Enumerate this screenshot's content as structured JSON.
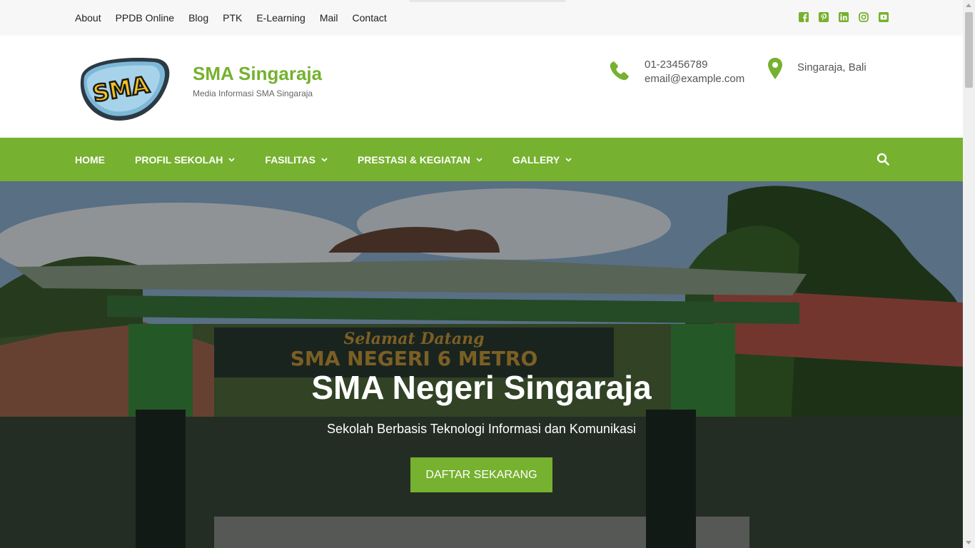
{
  "topbar": {
    "links": [
      "About",
      "PPDB Online",
      "Blog",
      "PTK",
      "E-Learning",
      "Mail",
      "Contact"
    ],
    "social_icons": [
      "facebook-icon",
      "pinterest-icon",
      "linkedin-icon",
      "instagram-icon",
      "youtube-icon"
    ]
  },
  "header": {
    "logo_text": "SMA",
    "site_title": "SMA Singaraja",
    "tagline": "Media Informasi SMA Singaraja",
    "phone": "01-23456789",
    "email": "email@example.com",
    "location": "Singaraja, Bali"
  },
  "nav": {
    "items": [
      "HOME",
      "PROFIL SEKOLAH",
      "FASILITAS",
      "PRESTASI & KEGIATAN",
      "GALLERY"
    ],
    "has_dropdown": [
      false,
      true,
      true,
      true,
      true
    ]
  },
  "hero": {
    "title": "SMA Negeri Singaraja",
    "subtitle": "Sekolah Berbasis Teknologi Informasi dan Komunikasi",
    "button_label": "DAFTAR SEKARANG",
    "gate_sign_line1": "Selamat Datang",
    "gate_sign_line2": "SMA NEGERI 6 METRO"
  },
  "colors": {
    "accent": "#76b12f",
    "topbar_bg": "#f7f7f7"
  }
}
